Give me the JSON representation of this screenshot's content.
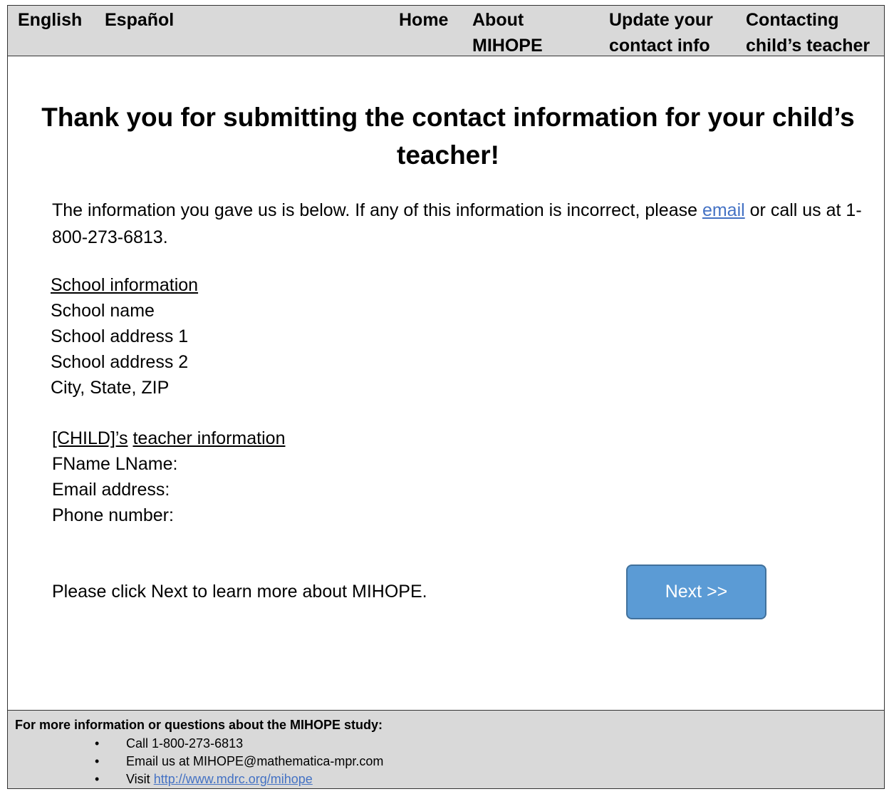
{
  "nav": {
    "english": "English",
    "espanol": "Español",
    "home": "Home",
    "about_line1": "About",
    "about_line2": "MIHOPE",
    "update_line1": "Update your",
    "update_line2": "contact info",
    "contact_line1": "Contacting",
    "contact_line2": "child’s teacher"
  },
  "heading": {
    "line1": "Thank you for submitting the contact information for your child’s",
    "line2": "teacher!"
  },
  "intro": {
    "before_link": "The information you gave us is below. If any of this information is incorrect, please ",
    "link": "email",
    "after_link": " or call us at 1-800-273-6813."
  },
  "school": {
    "title": "School information",
    "name": "School name",
    "address1": "School address 1",
    "address2": "School address 2",
    "city": "City, State, ZIP"
  },
  "teacher": {
    "child": "[CHILD]’s",
    "title": "teacher information",
    "name": "FName LName:",
    "email": "Email address:",
    "phone": "Phone number:"
  },
  "next": {
    "prompt": "Please click Next to learn more about MIHOPE.",
    "button": "Next >>"
  },
  "footer": {
    "title": "For more information or questions about the MIHOPE study:",
    "bullet": "•",
    "call": "Call 1-800-273-6813",
    "email": "Email us at MIHOPE@mathematica-mpr.com",
    "visit_prefix": "Visit ",
    "visit_link": "http://www.mdrc.org/mihope"
  },
  "colors": {
    "bar": "#d9d9d9",
    "button": "#5b9bd5",
    "link": "#4472c4"
  }
}
